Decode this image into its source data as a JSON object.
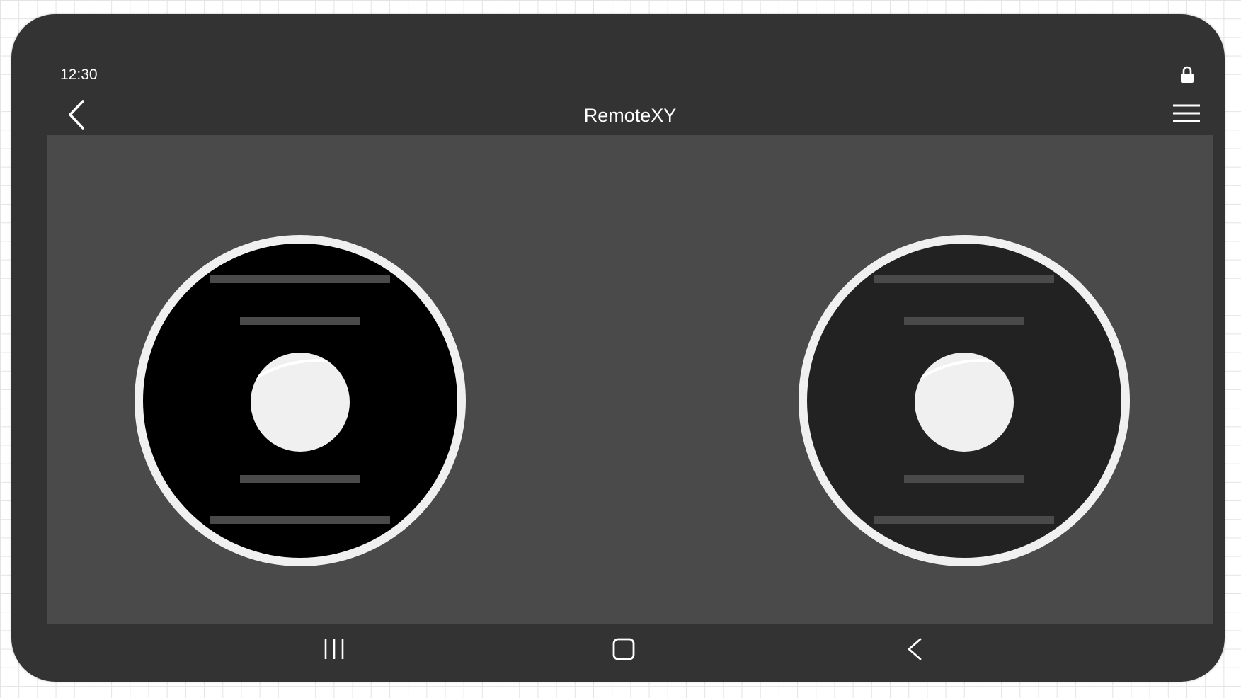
{
  "status": {
    "time": "12:30",
    "lock_icon": "lock-icon"
  },
  "appbar": {
    "title": "RemoteXY",
    "back_icon": "chevron-left-icon",
    "menu_icon": "hamburger-menu-icon"
  },
  "joysticks": [
    {
      "name": "left-joystick",
      "base_color": "#000000"
    },
    {
      "name": "right-joystick",
      "base_color": "#222222"
    }
  ],
  "navbar": {
    "recent_icon": "recent-apps-icon",
    "home_icon": "home-icon",
    "back_icon": "nav-back-icon"
  },
  "colors": {
    "device_frame": "#333333",
    "content_background": "#4a4a4a",
    "joystick_ring": "#f0f0f0",
    "joystick_knob": "#f0f0f0",
    "joystick_marks": "#4a4a4a"
  }
}
